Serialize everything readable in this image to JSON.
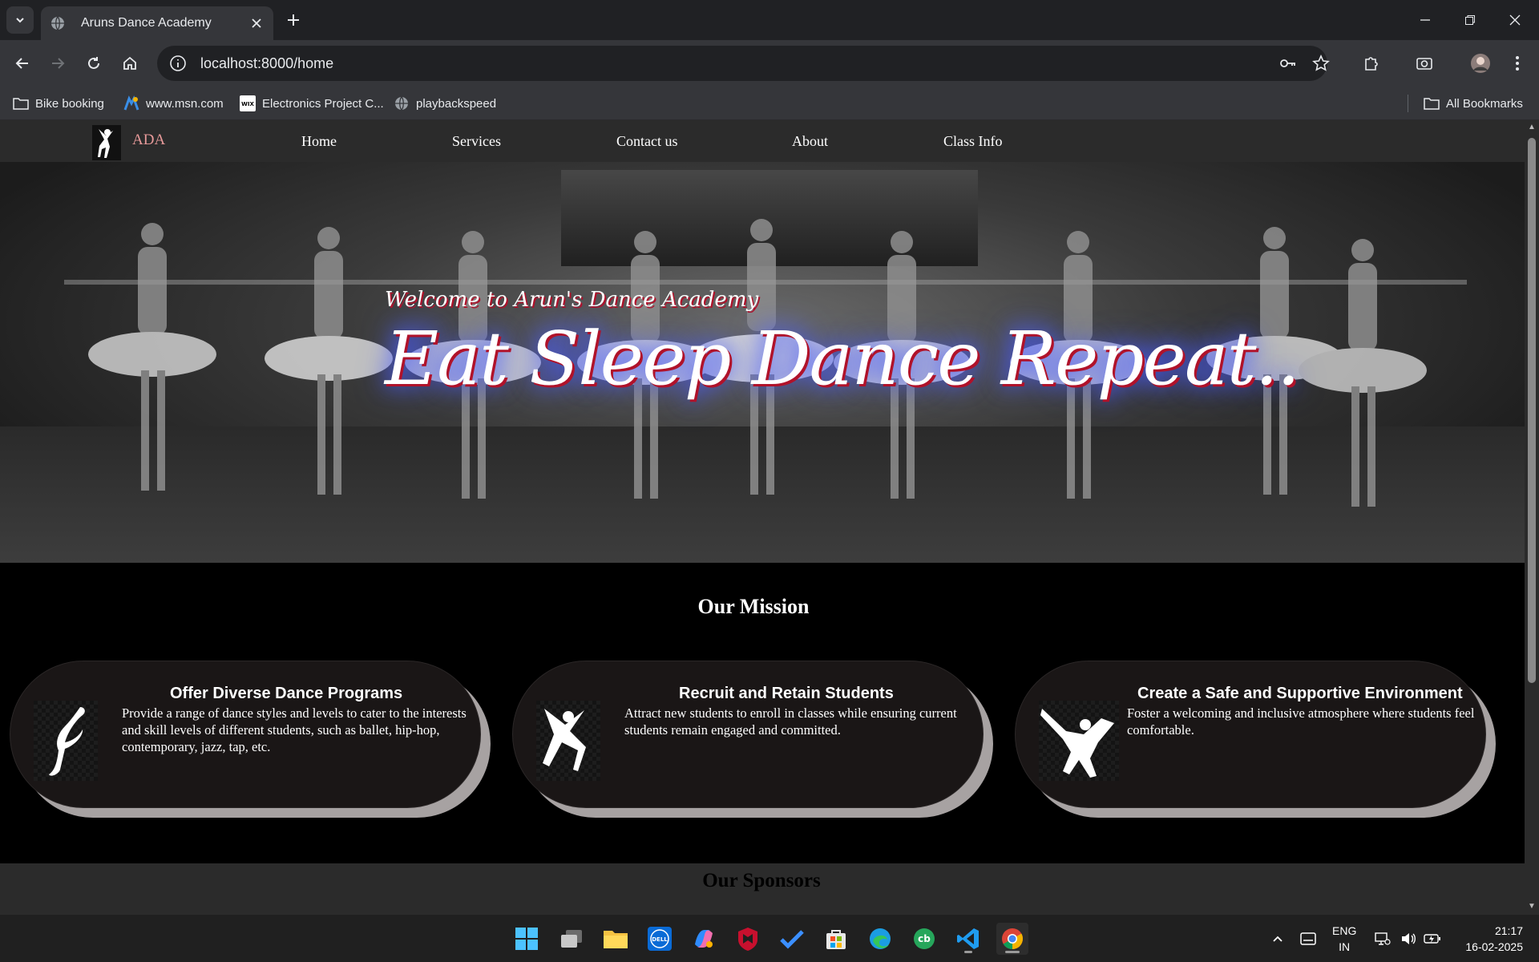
{
  "browser": {
    "tab_title": "Aruns Dance Academy",
    "url": "localhost:8000/home",
    "bookmarks": [
      {
        "label": "Bike booking",
        "icon": "folder-icon"
      },
      {
        "label": "www.msn.com",
        "icon": "msn-icon"
      },
      {
        "label": "Electronics Project C...",
        "icon": "wix-icon"
      },
      {
        "label": "playbackspeed",
        "icon": "globe-icon"
      }
    ],
    "all_bookmarks": "All Bookmarks"
  },
  "site": {
    "brand": "ADA",
    "nav": [
      "Home",
      "Services",
      "Contact us",
      "About",
      "Class Info"
    ],
    "hero": {
      "welcome": "Welcome to Arun's Dance Academy",
      "tagline": "Eat Sleep Dance Repeat.."
    },
    "mission": {
      "heading": "Our Mission",
      "cards": [
        {
          "title": "Offer Diverse Dance Programs",
          "text": "Provide a range of dance styles and levels to cater to the interests and skill levels of different students, such as ballet, hip-hop, contemporary, jazz, tap, etc.",
          "icon": "ballet-dancer-icon"
        },
        {
          "title": "Recruit and Retain Students",
          "text": "Attract new students to enroll in classes while ensuring current students remain engaged and committed.",
          "icon": "jumping-dancer-icon"
        },
        {
          "title": "Create a Safe and Supportive Environment",
          "text": "Foster a welcoming and inclusive atmosphere where students feel comfortable.",
          "icon": "breakdancer-icon"
        }
      ]
    },
    "sponsors_heading": "Our Sponsors"
  },
  "taskbar": {
    "lang_line1": "ENG",
    "lang_line2": "IN",
    "time": "21:17",
    "date": "16-02-2025"
  },
  "colors": {
    "brand": "#e89a9a",
    "nav_bg": "#2b2b2b",
    "card_bg": "#1a1616",
    "card_shadow": "#a7a2a2",
    "tagline_glow": "#4a5cff",
    "tagline_outline": "#b0122a"
  }
}
